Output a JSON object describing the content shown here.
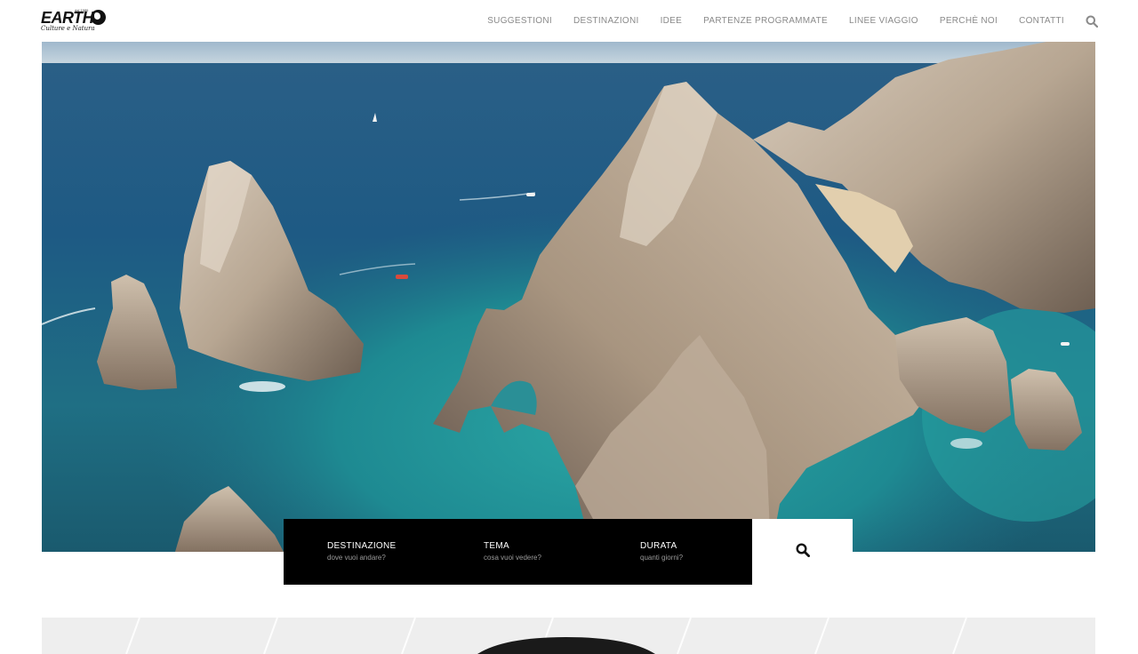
{
  "logo": {
    "name": "EARTH",
    "since": "dal 1986",
    "tagline": "Culture e Natura"
  },
  "nav": {
    "items": [
      {
        "label": "SUGGESTIONI"
      },
      {
        "label": "DESTINAZIONI"
      },
      {
        "label": "IDEE"
      },
      {
        "label": "PARTENZE PROGRAMMATE"
      },
      {
        "label": "LINEE VIAGGIO"
      },
      {
        "label": "PERCHÈ NOI"
      },
      {
        "label": "CONTATTI"
      }
    ],
    "search_icon": "search-icon"
  },
  "hero": {
    "image": "aerial-coastal-rock-arch-photo"
  },
  "search": {
    "fields": [
      {
        "title": "DESTINAZIONE",
        "subtitle": "dove vuoi andare?"
      },
      {
        "title": "TEMA",
        "subtitle": "cosa vuoi vedere?"
      },
      {
        "title": "DURATA",
        "subtitle": "quanti giorni?"
      }
    ],
    "button_icon": "search-icon"
  },
  "colors": {
    "nav_text": "#8a8a8a",
    "search_bg": "#000000",
    "strip_bg": "#eeeeee"
  }
}
